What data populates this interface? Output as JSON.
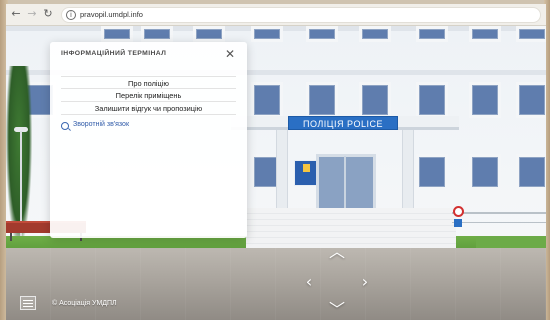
{
  "browser": {
    "back_icon": "arrow-left-icon",
    "forward_icon": "arrow-right-icon",
    "reload_icon": "reload-icon",
    "info_icon": "info-icon",
    "url": "pravopil.umdpl.info"
  },
  "scene": {
    "building_sign": "ПОЛІЦІЯ  POLICE",
    "colors": {
      "sign_blue": "#2a6fc4",
      "window_blue": "#5f7dae",
      "grass": "#6fae47",
      "bench": "#a33a2d"
    }
  },
  "dialog": {
    "title": "ІНФОРМАЦІЙНИЙ ТЕРМІНАЛ",
    "close_icon": "close-icon",
    "menu": [
      {
        "label": "Про поліцію"
      },
      {
        "label": "Перелік приміщень"
      },
      {
        "label": "Залишити відгук чи пропозицію"
      }
    ],
    "feedback": {
      "icon": "search-icon",
      "label": "Зворотній зв'язок"
    }
  },
  "navigation": {
    "up_icon": "chevron-up-icon",
    "left_icon": "chevron-left-icon",
    "right_icon": "chevron-right-icon",
    "down_icon": "chevron-down-icon"
  },
  "footer": {
    "logo_icon": "umdpl-logo-icon",
    "copyright": "© Асоціація УМДПЛ"
  }
}
